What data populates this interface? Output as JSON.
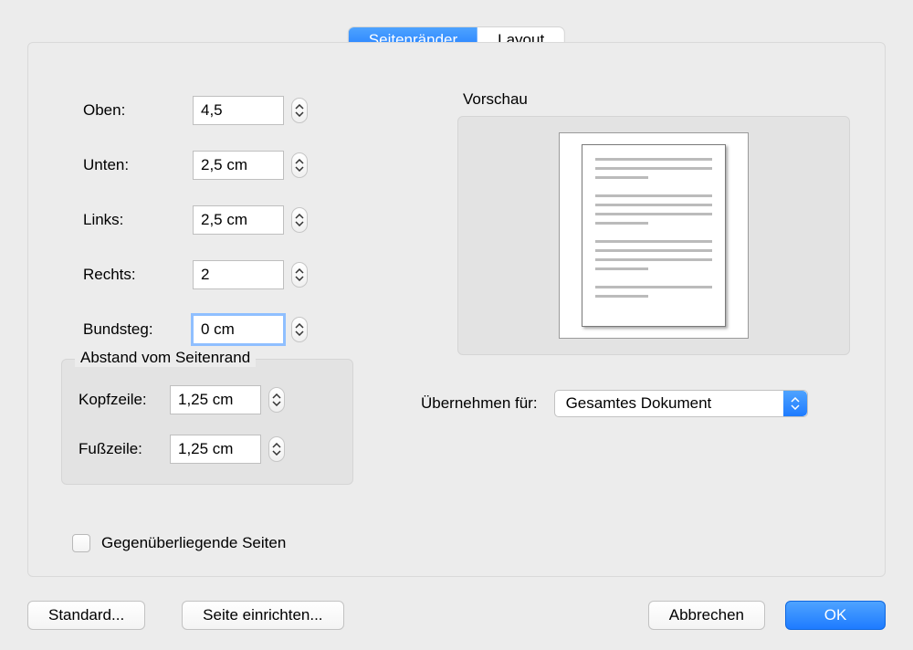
{
  "tabs": {
    "margins": "Seitenränder",
    "layout": "Layout"
  },
  "margins": {
    "top_label": "Oben:",
    "top_value": "4,5",
    "bottom_label": "Unten:",
    "bottom_value": "2,5 cm",
    "left_label": "Links:",
    "left_value": "2,5 cm",
    "right_label": "Rechts:",
    "right_value": "2",
    "gutter_label": "Bundsteg:",
    "gutter_value": "0 cm"
  },
  "edge": {
    "legend": "Abstand vom Seitenrand",
    "header_label": "Kopfzeile:",
    "header_value": "1,25 cm",
    "footer_label": "Fußzeile:",
    "footer_value": "1,25 cm"
  },
  "mirror": {
    "label": "Gegenüberliegende Seiten",
    "checked": false
  },
  "preview": {
    "title": "Vorschau"
  },
  "apply": {
    "label": "Übernehmen für:",
    "value": "Gesamtes Dokument"
  },
  "buttons": {
    "standard": "Standard...",
    "page_setup": "Seite einrichten...",
    "cancel": "Abbrechen",
    "ok": "OK"
  }
}
